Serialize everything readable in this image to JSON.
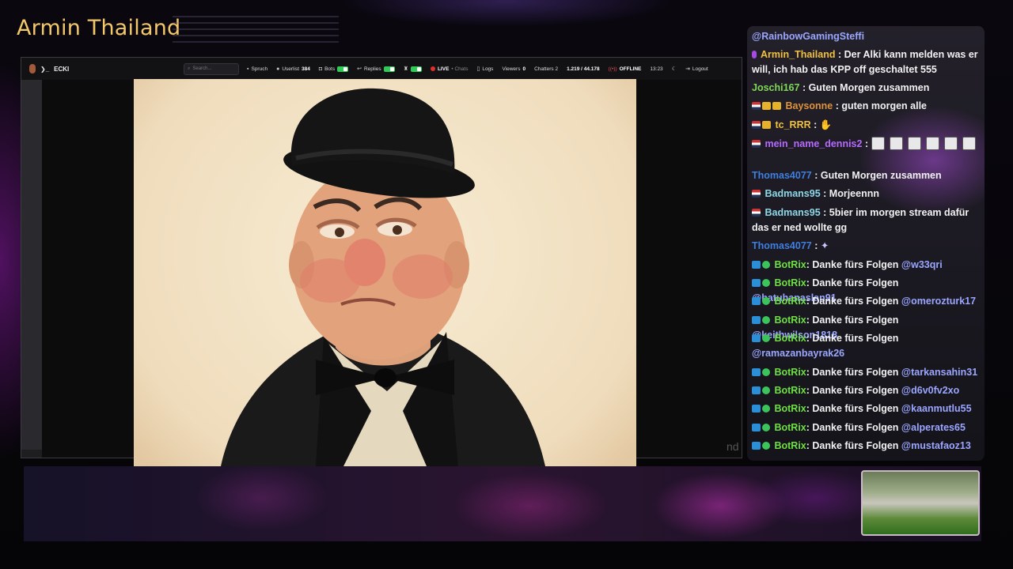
{
  "stream": {
    "title": "Armin Thailand"
  },
  "toolbar": {
    "brand": "ECKI",
    "search_placeholder": "Search...",
    "spruch": "Spruch",
    "userlist_label": "Userlist",
    "userlist_count": "384",
    "bots": "Bots",
    "replies": "Replies",
    "live_label": "LIVE",
    "live_sub": "• Chats",
    "logs": "Logs",
    "viewers_label": "Viewers",
    "viewers_count": "0",
    "chatters": "Chatters 2",
    "stats": "1.219 / 44.178",
    "offline": "OFFLINE",
    "time": "13:23",
    "logout": "Logout"
  },
  "stage": {
    "partial_label": "nd"
  },
  "chat": {
    "messages": [
      {
        "user": "@RainbowGamingSteffi",
        "text": "",
        "color": "#9aa6ff"
      },
      {
        "user": "Armin_Thailand",
        "text": ": Der Alki kann melden was er will, ich hab das KPP off geschaltet 555",
        "color": "#f0c040"
      },
      {
        "user": "Joschi167",
        "text": ": Guten Morgen zusammen",
        "color": "#7ed957"
      },
      {
        "user": "Baysonne",
        "text": ": guten morgen alle",
        "color": "#e0933a"
      },
      {
        "user": "tc_RRR",
        "text": ":",
        "color": "#f0c040"
      },
      {
        "user": "mein_name_dennis2",
        "text": ":",
        "color": "#b56bff"
      },
      {
        "user": "Thomas4077",
        "text": ": Guten Morgen zusammen",
        "color": "#3f7fe0"
      },
      {
        "user": "Badmans95",
        "text": ": Morjeennn",
        "color": "#8ed8e8"
      },
      {
        "user": "Badmans95",
        "text": ": 5bier im morgen stream dafür das er ned wollte gg",
        "color": "#8ed8e8"
      },
      {
        "user": "Thomas4077",
        "text": ":",
        "color": "#3f7fe0"
      },
      {
        "user": "BotRix",
        "text": ": Danke fürs Folgen ",
        "mention": "@w33qri",
        "color": "#6ee043"
      },
      {
        "user": "BotRix",
        "text": ": Danke fürs Folgen ",
        "mention": "@batuhanaslan91",
        "color": "#6ee043"
      },
      {
        "user": "BotRix",
        "text": ": Danke fürs Folgen ",
        "mention": "@omerozturk17",
        "color": "#6ee043"
      },
      {
        "user": "BotRix",
        "text": ": Danke fürs Folgen ",
        "mention": "@keithwilson1818",
        "color": "#6ee043"
      },
      {
        "user": "BotRix",
        "text": ": Danke fürs Folgen ",
        "mention": "@ramazanbayrak26",
        "color": "#6ee043"
      },
      {
        "user": "BotRix",
        "text": ": Danke fürs Folgen ",
        "mention": "@tarkansahin31",
        "color": "#6ee043"
      },
      {
        "user": "BotRix",
        "text": ": Danke fürs Folgen ",
        "mention": "@d6v0fv2xo",
        "color": "#6ee043"
      },
      {
        "user": "BotRix",
        "text": ": Danke fürs Folgen ",
        "mention": "@kaanmutlu55",
        "color": "#6ee043"
      },
      {
        "user": "BotRix",
        "text": ": Danke fürs Folgen ",
        "mention": "@alperates65",
        "color": "#6ee043"
      },
      {
        "user": "BotRix",
        "text": ": Danke fürs Folgen ",
        "mention": "@mustafaoz13",
        "color": "#6ee043"
      }
    ]
  },
  "colors": {
    "title": "#f3c86a",
    "live": "#e0302e",
    "toggle_on": "#2ecc55",
    "offline": "#e85050"
  }
}
